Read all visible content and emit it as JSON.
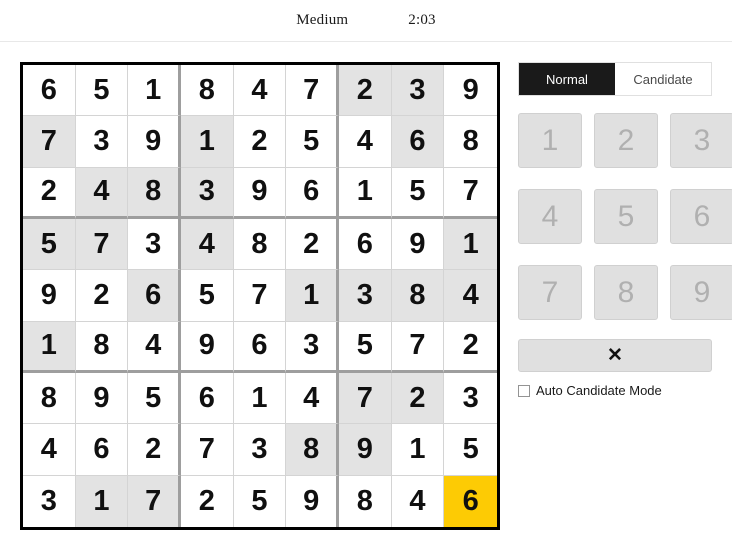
{
  "header": {
    "difficulty": "Medium",
    "timer": "2:03"
  },
  "board": {
    "selected_cell": {
      "row": 8,
      "col": 8,
      "value": "6"
    },
    "colors": {
      "given_cell_bg": "#e3e3e3",
      "empty_cell_bg": "#ffffff",
      "selected_cell_bg": "#fdcb04",
      "grid_border": "#000000",
      "block_line": "#9e9e9e",
      "cell_line": "#d4d4d4",
      "digit": "#101010"
    },
    "rows": [
      {
        "values": [
          "6",
          "5",
          "1",
          "8",
          "4",
          "7",
          "2",
          "3",
          "9"
        ],
        "given": [
          false,
          false,
          false,
          false,
          false,
          false,
          true,
          true,
          false
        ]
      },
      {
        "values": [
          "7",
          "3",
          "9",
          "1",
          "2",
          "5",
          "4",
          "6",
          "8"
        ],
        "given": [
          true,
          false,
          false,
          true,
          false,
          false,
          false,
          true,
          false
        ]
      },
      {
        "values": [
          "2",
          "4",
          "8",
          "3",
          "9",
          "6",
          "1",
          "5",
          "7"
        ],
        "given": [
          false,
          true,
          true,
          true,
          false,
          false,
          false,
          false,
          false
        ]
      },
      {
        "values": [
          "5",
          "7",
          "3",
          "4",
          "8",
          "2",
          "6",
          "9",
          "1"
        ],
        "given": [
          true,
          true,
          false,
          true,
          false,
          false,
          false,
          false,
          true
        ]
      },
      {
        "values": [
          "9",
          "2",
          "6",
          "5",
          "7",
          "1",
          "3",
          "8",
          "4"
        ],
        "given": [
          false,
          false,
          true,
          false,
          false,
          true,
          true,
          true,
          true
        ]
      },
      {
        "values": [
          "1",
          "8",
          "4",
          "9",
          "6",
          "3",
          "5",
          "7",
          "2"
        ],
        "given": [
          true,
          false,
          false,
          false,
          false,
          false,
          false,
          false,
          false
        ]
      },
      {
        "values": [
          "8",
          "9",
          "5",
          "6",
          "1",
          "4",
          "7",
          "2",
          "3"
        ],
        "given": [
          false,
          false,
          false,
          false,
          false,
          false,
          true,
          true,
          false
        ]
      },
      {
        "values": [
          "4",
          "6",
          "2",
          "7",
          "3",
          "8",
          "9",
          "1",
          "5"
        ],
        "given": [
          false,
          false,
          false,
          false,
          false,
          true,
          true,
          false,
          false
        ]
      },
      {
        "values": [
          "3",
          "1",
          "7",
          "2",
          "5",
          "9",
          "8",
          "4",
          "6"
        ],
        "given": [
          false,
          true,
          true,
          false,
          false,
          false,
          false,
          false,
          false
        ]
      }
    ]
  },
  "panel": {
    "modes": [
      {
        "label": "Normal",
        "active": true
      },
      {
        "label": "Candidate",
        "active": false
      }
    ],
    "numbers": [
      "1",
      "2",
      "3",
      "4",
      "5",
      "6",
      "7",
      "8",
      "9"
    ],
    "erase_label": "✕",
    "auto_candidate_label": "Auto Candidate Mode",
    "auto_candidate_checked": false
  }
}
